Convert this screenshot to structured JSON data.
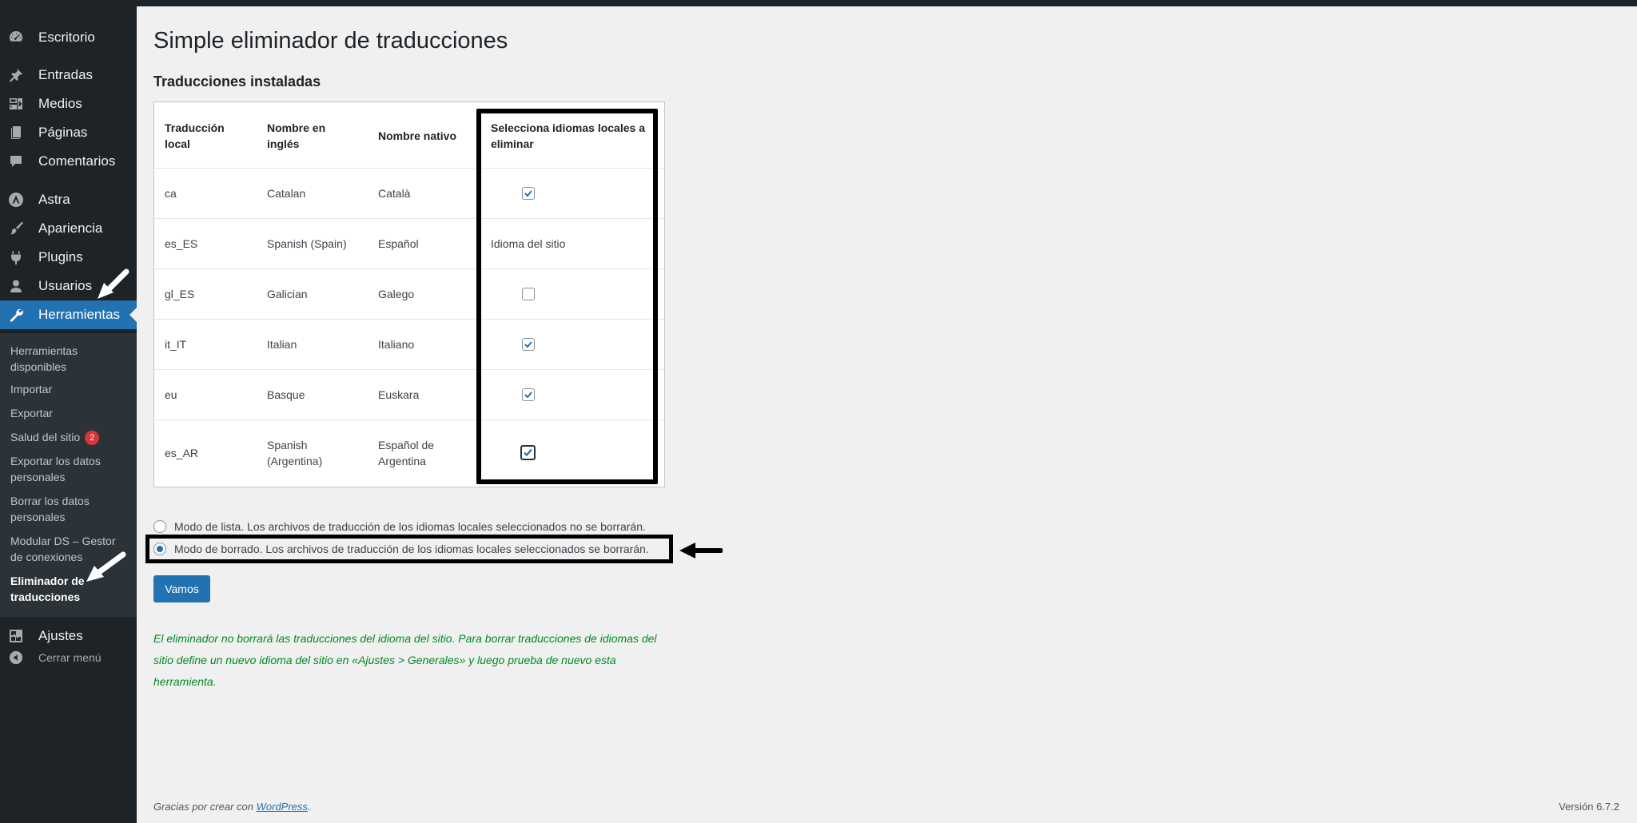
{
  "sidebar": {
    "items": [
      {
        "label": "Escritorio",
        "icon": "dashboard-icon"
      },
      {
        "label": "Entradas",
        "icon": "pin-icon"
      },
      {
        "label": "Medios",
        "icon": "media-icon"
      },
      {
        "label": "Páginas",
        "icon": "page-icon"
      },
      {
        "label": "Comentarios",
        "icon": "comment-icon"
      },
      {
        "label": "Astra",
        "icon": "astra-icon"
      },
      {
        "label": "Apariencia",
        "icon": "brush-icon"
      },
      {
        "label": "Plugins",
        "icon": "plugin-icon"
      },
      {
        "label": "Usuarios",
        "icon": "user-icon"
      },
      {
        "label": "Herramientas",
        "icon": "wrench-icon"
      },
      {
        "label": "Ajustes",
        "icon": "settings-icon"
      }
    ],
    "submenu": [
      {
        "label": "Herramientas disponibles"
      },
      {
        "label": "Importar"
      },
      {
        "label": "Exportar"
      },
      {
        "label": "Salud del sitio",
        "badge": "2"
      },
      {
        "label": "Exportar los datos personales"
      },
      {
        "label": "Borrar los datos personales"
      },
      {
        "label": "Modular DS – Gestor de conexiones"
      },
      {
        "label": "Eliminador de traducciones"
      }
    ],
    "collapse_label": "Cerrar menú"
  },
  "page": {
    "title": "Simple eliminador de traducciones",
    "section_title": "Traducciones instaladas"
  },
  "table": {
    "headers": [
      "Traducción local",
      "Nombre en inglés",
      "Nombre nativo",
      "Selecciona idiomas locales a eliminar"
    ],
    "rows": [
      {
        "locale": "ca",
        "english": "Catalan",
        "native": "Català",
        "checked": true
      },
      {
        "locale": "es_ES",
        "english": "Spanish (Spain)",
        "native": "Español",
        "site_language_text": "Idioma del sitio"
      },
      {
        "locale": "gl_ES",
        "english": "Galician",
        "native": "Galego",
        "checked": false
      },
      {
        "locale": "it_IT",
        "english": "Italian",
        "native": "Italiano",
        "checked": true
      },
      {
        "locale": "eu",
        "english": "Basque",
        "native": "Euskara",
        "checked": true
      },
      {
        "locale": "es_AR",
        "english": "Spanish (Argentina)",
        "native": "Español de Argentina",
        "checked": true
      }
    ]
  },
  "modes": [
    {
      "label": "Modo de lista. Los archivos de traducción de los idiomas locales seleccionados no se borrarán.",
      "checked": false
    },
    {
      "label": "Modo de borrado. Los archivos de traducción de los idiomas locales seleccionados se borrarán.",
      "checked": true
    }
  ],
  "submit_label": "Vamos",
  "note": "El eliminador no borrará las traducciones del idioma del sitio. Para borrar traducciones de idiomas del sitio define un nuevo idioma del sitio en «Ajustes > Generales» y luego prueba de nuevo esta herramienta.",
  "footer": {
    "thanks_prefix": "Gracias por crear con ",
    "thanks_link": "WordPress",
    "thanks_suffix": ".",
    "version": "Versión 6.7.2"
  },
  "colors": {
    "sidebar_bg": "#1d2327",
    "submenu_bg": "#2c3338",
    "accent": "#2271b1",
    "note_green": "#008a20",
    "badge_red": "#d63638"
  }
}
